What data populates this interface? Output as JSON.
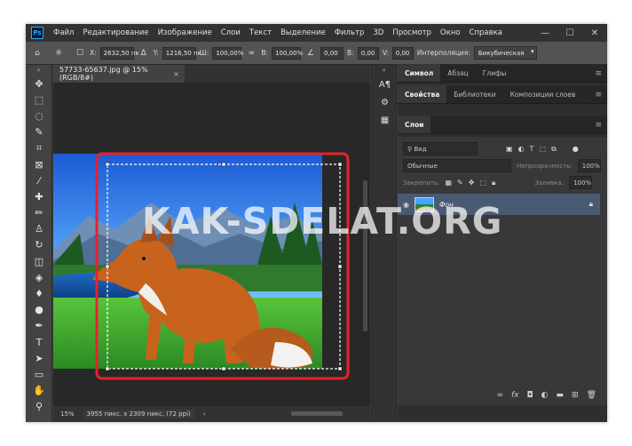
{
  "app": {
    "logo": "Ps",
    "menu": [
      "Файл",
      "Редактирование",
      "Изображение",
      "Слои",
      "Текст",
      "Выделение",
      "Фильтр",
      "3D",
      "Просмотр",
      "Окно",
      "Справка"
    ],
    "window_controls": {
      "minimize": "—",
      "maximize": "☐",
      "close": "✕"
    }
  },
  "options_bar": {
    "x_label": "X:",
    "x_value": "2632,50 пк",
    "y_label": "Y:",
    "y_value": "1216,50 пк",
    "w_label": "Ш:",
    "w_value": "100,00%",
    "h_label": "В:",
    "h_value": "100,00%",
    "angle_value": "0,00",
    "hskew_label": "В:",
    "hskew_value": "0,00",
    "vskew_label": "V:",
    "vskew_value": "0,00",
    "interp_label": "Интерполяция:",
    "interp_value": "Бикубическая"
  },
  "document": {
    "tab_title": "57733-65637.jpg @ 15% (RGB/8#)",
    "tab_close": "×"
  },
  "status_bar": {
    "zoom": "15%",
    "info": "3955 пикс. x 2309 пикс. (72 ppi)"
  },
  "panels": {
    "row1_tabs": [
      "Символ",
      "Абзац",
      "Глифы"
    ],
    "row2_tabs": [
      "Свойства",
      "Библиотеки",
      "Композиции слоев"
    ],
    "row3_tabs": [
      "Слои"
    ],
    "layers": {
      "filter_placeholder": "Вид",
      "blend_mode": "Обычные",
      "opacity_label": "Непрозрачность:",
      "opacity_value": "100%",
      "lock_label": "Закрепить:",
      "fill_label": "Заливка:",
      "fill_value": "100%",
      "layer_name": "Фон"
    }
  },
  "watermark": "KAK-SDELAT.ORG",
  "colors": {
    "selection_highlight": "#e8212b",
    "layer_selected": "#4b5a73",
    "accent": "#31a8ff"
  }
}
